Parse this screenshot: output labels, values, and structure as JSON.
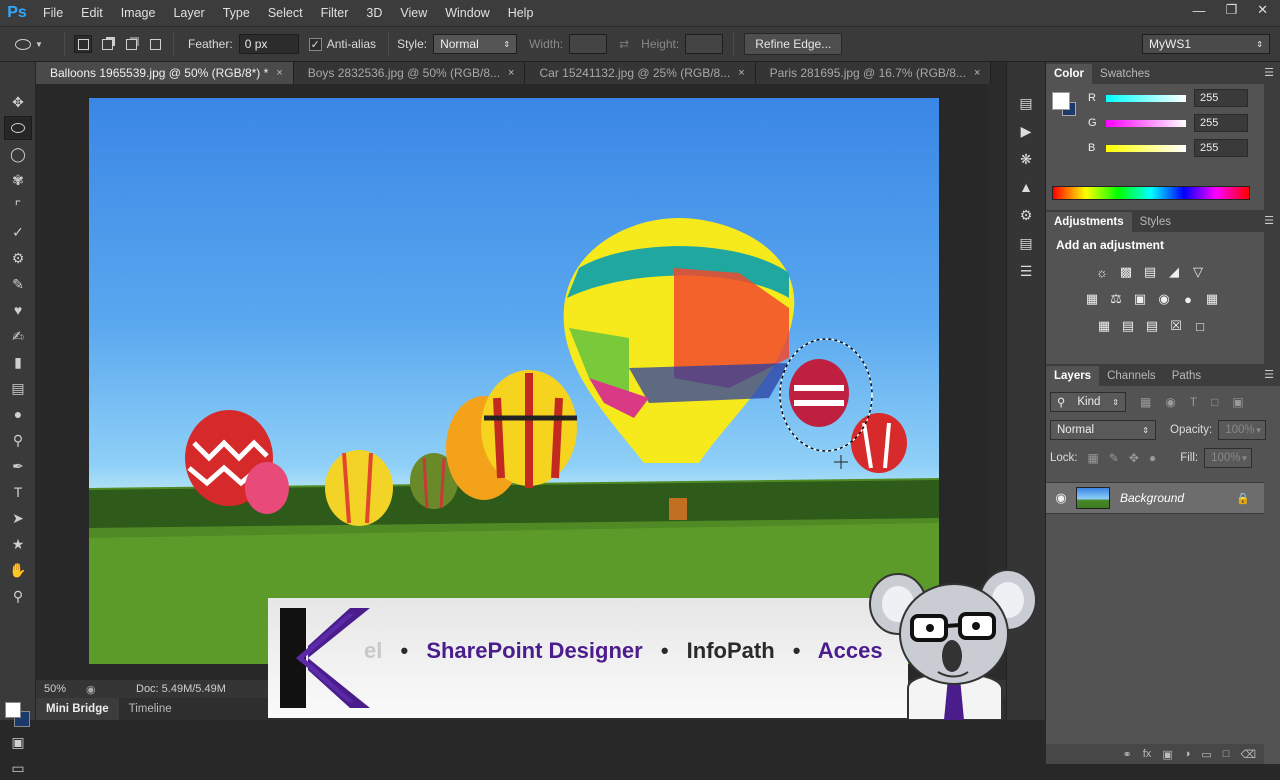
{
  "app": {
    "logo": "Ps",
    "menu": [
      "File",
      "Edit",
      "Image",
      "Layer",
      "Type",
      "Select",
      "Filter",
      "3D",
      "View",
      "Window",
      "Help"
    ],
    "window_controls": [
      "minimize",
      "restore",
      "close"
    ]
  },
  "options": {
    "feather_label": "Feather:",
    "feather_value": "0 px",
    "antialias_label": "Anti-alias",
    "antialias_checked": true,
    "style_label": "Style:",
    "style_value": "Normal",
    "width_label": "Width:",
    "height_label": "Height:",
    "refine_edge": "Refine Edge...",
    "workspace": "MyWS1"
  },
  "tabs": [
    {
      "label": "Balloons 1965539.jpg @ 50% (RGB/8*) *",
      "active": true
    },
    {
      "label": "Boys 2832536.jpg @ 50% (RGB/8...",
      "active": false
    },
    {
      "label": "Car 15241132.jpg @ 25% (RGB/8...",
      "active": false
    },
    {
      "label": "Paris 281695.jpg @ 16.7% (RGB/8...",
      "active": false
    }
  ],
  "tab_close": "×",
  "status": {
    "zoom": "50%",
    "doc": "Doc: 5.49M/5.49M"
  },
  "bottom_tabs": [
    "Mini Bridge",
    "Timeline"
  ],
  "color_panel": {
    "tabs": [
      "Color",
      "Swatches"
    ],
    "channels": [
      {
        "name": "R",
        "value": "255",
        "color": "#00e5e5"
      },
      {
        "name": "G",
        "value": "255",
        "color": "#e500e5"
      },
      {
        "name": "B",
        "value": "255",
        "color": "#e5e500"
      }
    ]
  },
  "adjustments_panel": {
    "tabs": [
      "Adjustments",
      "Styles"
    ],
    "title": "Add an adjustment"
  },
  "layers_panel": {
    "tabs": [
      "Layers",
      "Channels",
      "Paths"
    ],
    "kind": "Kind",
    "blend_mode": "Normal",
    "opacity_label": "Opacity:",
    "opacity_value": "100%",
    "lock_label": "Lock:",
    "fill_label": "Fill:",
    "fill_value": "100%",
    "layers": [
      {
        "name": "Background",
        "locked": true,
        "visible": true
      }
    ]
  },
  "banner": {
    "items": [
      "el",
      "SharePoint Designer",
      "InfoPath",
      "Acces"
    ],
    "bullet": "•"
  }
}
